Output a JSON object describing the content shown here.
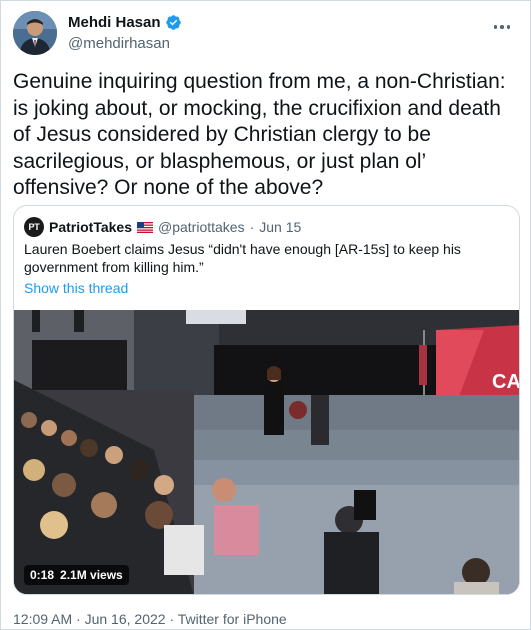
{
  "author": {
    "name": "Mehdi Hasan",
    "handle": "@mehdirhasan",
    "verified": true
  },
  "tweet": {
    "text": "Genuine inquiring question from me, a non-Christian: is joking about, or mocking, the crucifixion and death of Jesus considered by Christian clergy to be sacrilegious, or blasphemous, or just plan ol’ offensive? Or none of the above?"
  },
  "quoted": {
    "avatar_text": "PT",
    "name": "PatriotTakes",
    "flag_icon": "us-flag-icon",
    "handle": "@patriottakes",
    "separator": "·",
    "date": "Jun 15",
    "text": "Lauren Boebert claims Jesus “didn't have enough [AR-15s] to keep his government from killing him.”",
    "show_thread": "Show this thread",
    "video": {
      "time": "0:18",
      "views": "2.1M views",
      "screen_text": "CAM"
    }
  },
  "footer": {
    "meta": "12:09 AM · Jun 16, 2022 · Twitter for iPhone"
  },
  "colors": {
    "accent": "#1d9bf0",
    "secondary_text": "#536471",
    "border": "#cfd9de",
    "screen_red": "#d93a4a"
  }
}
